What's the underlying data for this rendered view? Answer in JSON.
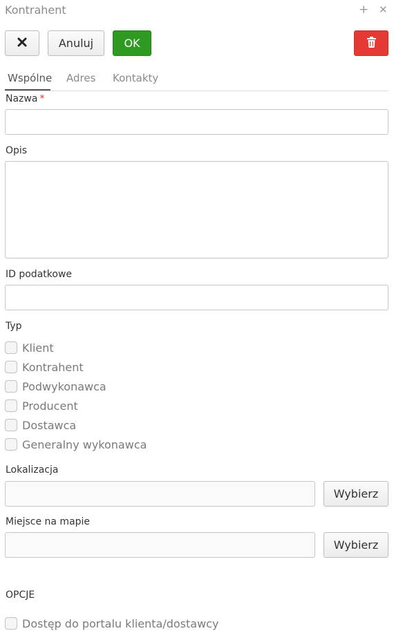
{
  "window": {
    "title": "Kontrahent",
    "maximize_glyph": "+",
    "close_glyph": "✕"
  },
  "toolbar": {
    "close_glyph": "✕",
    "cancel_label": "Anuluj",
    "ok_label": "OK",
    "delete_icon": "trash-icon"
  },
  "tabs": [
    {
      "label": "Wspólne",
      "active": true
    },
    {
      "label": "Adres",
      "active": false
    },
    {
      "label": "Kontakty",
      "active": false
    }
  ],
  "form": {
    "name": {
      "label": "Nazwa",
      "required_mark": "*",
      "value": ""
    },
    "description": {
      "label": "Opis",
      "value": ""
    },
    "tax_id": {
      "label": "ID podatkowe",
      "value": ""
    },
    "type": {
      "label": "Typ",
      "options": [
        {
          "label": "Klient",
          "checked": false
        },
        {
          "label": "Kontrahent",
          "checked": false
        },
        {
          "label": "Podwykonawca",
          "checked": false
        },
        {
          "label": "Producent",
          "checked": false
        },
        {
          "label": "Dostawca",
          "checked": false
        },
        {
          "label": "Generalny wykonawca",
          "checked": false
        }
      ]
    },
    "location": {
      "label": "Lokalizacja",
      "value": "",
      "button_label": "Wybierz"
    },
    "map_place": {
      "label": "Miejsce na mapie",
      "value": "",
      "button_label": "Wybierz"
    }
  },
  "options": {
    "heading": "OPCJE",
    "portal_access": {
      "label": "Dostęp do portalu klienta/dostawcy",
      "checked": false
    }
  },
  "colors": {
    "ok": "#2f9a22",
    "danger": "#e53935",
    "required": "#e53935"
  }
}
